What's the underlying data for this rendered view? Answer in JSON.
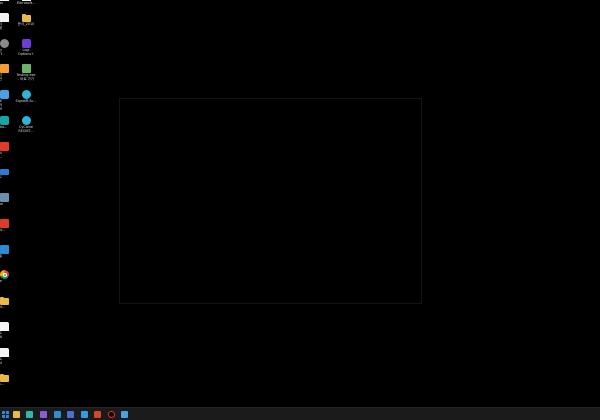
{
  "desktop": {
    "icons_col0": [
      {
        "label": "ndows",
        "icon": "document-icon"
      },
      {
        "label": "의 식제",
        "icon": "document-icon"
      },
      {
        "label": "itify\n.3.771",
        "icon": "gear-icon"
      },
      {
        "label": "실 자전",
        "icon": "app-orange-icon"
      },
      {
        "label": "로 토어\n2019",
        "icon": "shield-icon"
      },
      {
        "label": "Creatio...",
        "icon": "app-teal-icon"
      },
      {
        "label": "00 8...",
        "icon": "pdf-icon"
      },
      {
        "label": "PC",
        "icon": "monitor-icon"
      },
      {
        "label": "ell.exe",
        "icon": "exe-icon"
      },
      {
        "label": "Credit...",
        "icon": "pdf-icon"
      },
      {
        "label": "로필",
        "icon": "app-blue-icon"
      },
      {
        "label": "rome",
        "icon": "chrome-icon"
      },
      {
        "label": "Credit...",
        "icon": "folder-icon"
      },
      {
        "label": "핵스트\n25.56",
        "icon": "document-icon"
      },
      {
        "label": "핵스트\n45.64",
        "icon": "document-icon"
      },
      {
        "label": "ptTes...",
        "icon": "folder-icon"
      }
    ],
    "icons_col1": [
      {
        "label": "Microsoft...",
        "icon": "document-icon"
      },
      {
        "label": "문서_2010",
        "icon": "folder-icon"
      },
      {
        "label": "Logi\nOptions+",
        "icon": "app-purple-icon"
      },
      {
        "label": "Testing.exe\n- 바로 가기",
        "icon": "app-green-icon"
      },
      {
        "label": "SignalR.Sc...",
        "icon": "app-cyan-icon"
      },
      {
        "label": "CyClone\nREGIST...",
        "icon": "app-cyan-icon"
      }
    ]
  },
  "taskbar": {
    "icons": [
      {
        "name": "windows-start-icon",
        "color": "#2b8ae0"
      },
      {
        "name": "file-explorer-icon",
        "color": "#e9b949"
      },
      {
        "name": "edge-browser-icon",
        "color": "#2fb8a8"
      },
      {
        "name": "visual-studio-icon",
        "color": "#8a5cd6"
      },
      {
        "name": "visual-studio-code-icon",
        "color": "#2c8ed6"
      },
      {
        "name": "app-icon",
        "color": "#4a6fd6"
      },
      {
        "name": "photoshop-icon",
        "color": "#2aa0e8"
      },
      {
        "name": "powerpoint-icon",
        "color": "#d24726"
      },
      {
        "name": "record-icon",
        "color": "#e03030"
      },
      {
        "name": "app-window-icon",
        "color": "#4aa0e0"
      }
    ]
  }
}
